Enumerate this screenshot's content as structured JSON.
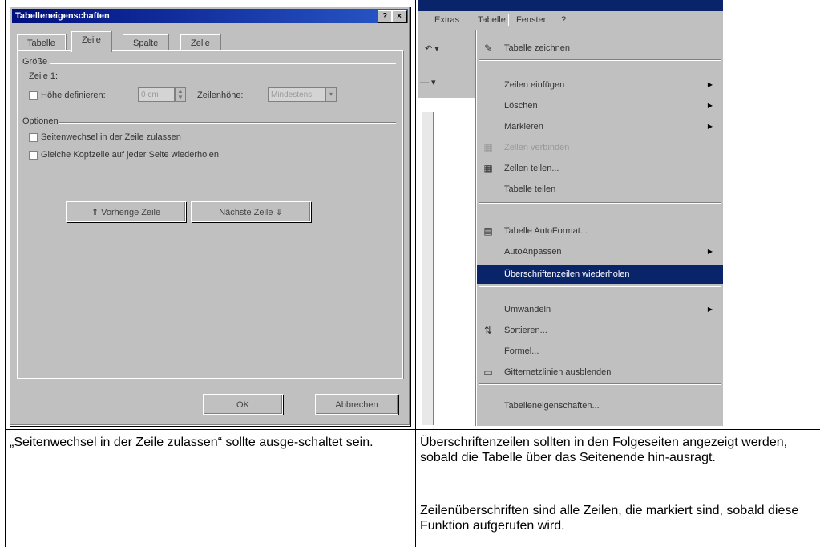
{
  "dialog": {
    "title": "Tabelleneigenschaften",
    "tabs": [
      "Tabelle",
      "Zeile",
      "Spalte",
      "Zelle"
    ],
    "active_tab": "Zeile",
    "size_group": "Größe",
    "row_label": "Zeile 1:",
    "height_checkbox": "Höhe definieren:",
    "height_value": "0 cm",
    "row_height_label": "Zeilenhöhe:",
    "row_height_value": "Mindestens",
    "options_group": "Optionen",
    "option1": "Seitenwechsel in der Zeile zulassen",
    "option2": "Gleiche Kopfzeile auf jeder Seite wiederholen",
    "prev_row_button": "⇑ Vorherige Zeile",
    "next_row_button": "Nächste Zeile ⇓",
    "ok_button": "OK",
    "cancel_button": "Abbrechen"
  },
  "menu_shot": {
    "menubar": [
      "Extras",
      "Tabelle",
      "Fenster",
      "?"
    ],
    "toolbar_fragments": [
      "↶ ▾",
      "—  ▾"
    ],
    "items": [
      {
        "label": "Tabelle zeichnen",
        "icon": "pencil-icon",
        "glyph": "✎",
        "arrow": false,
        "state": "normal"
      },
      {
        "label": "Zeilen einfügen",
        "icon": "",
        "glyph": "",
        "arrow": true,
        "state": "normal"
      },
      {
        "label": "Löschen",
        "icon": "",
        "glyph": "",
        "arrow": true,
        "state": "normal"
      },
      {
        "label": "Markieren",
        "icon": "",
        "glyph": "",
        "arrow": true,
        "state": "normal"
      },
      {
        "label": "Zellen verbinden",
        "icon": "merge-cells-icon",
        "glyph": "▦",
        "arrow": false,
        "state": "disabled"
      },
      {
        "label": "Zellen teilen...",
        "icon": "split-cells-icon",
        "glyph": "▦",
        "arrow": false,
        "state": "normal"
      },
      {
        "label": "Tabelle teilen",
        "icon": "",
        "glyph": "",
        "arrow": false,
        "state": "normal"
      },
      {
        "label": "Tabelle AutoFormat...",
        "icon": "autoformat-icon",
        "glyph": "▤",
        "arrow": false,
        "state": "normal"
      },
      {
        "label": "AutoAnpassen",
        "icon": "",
        "glyph": "",
        "arrow": true,
        "state": "normal"
      },
      {
        "label": "Überschriftenzeilen wiederholen",
        "icon": "",
        "glyph": "",
        "arrow": false,
        "state": "highlighted"
      },
      {
        "label": "Umwandeln",
        "icon": "",
        "glyph": "",
        "arrow": true,
        "state": "normal"
      },
      {
        "label": "Sortieren...",
        "icon": "sort-icon",
        "glyph": "⇅",
        "arrow": false,
        "state": "normal"
      },
      {
        "label": "Formel...",
        "icon": "",
        "glyph": "",
        "arrow": false,
        "state": "normal"
      },
      {
        "label": "Gitternetzlinien ausblenden",
        "icon": "gridlines-icon",
        "glyph": "▭",
        "arrow": false,
        "state": "normal"
      },
      {
        "label": "Tabelleneigenschaften...",
        "icon": "",
        "glyph": "",
        "arrow": false,
        "state": "normal"
      }
    ]
  },
  "captions": {
    "left": "„Seitenwechsel in der Zeile zulassen“ sollte ausge-schaltet sein.",
    "right_p1": "Überschriftenzeilen sollten in den Folgeseiten angezeigt werden, sobald die Tabelle über das Seitenende hin-ausragt.",
    "right_p2": "Zeilenüberschriften sind alle Zeilen, die markiert sind, sobald diese Funktion aufgerufen wird."
  },
  "colors": {
    "title_bar": "#0a246a",
    "highlight": "#0a246a",
    "dialog_bg": "#c0c0c0"
  }
}
